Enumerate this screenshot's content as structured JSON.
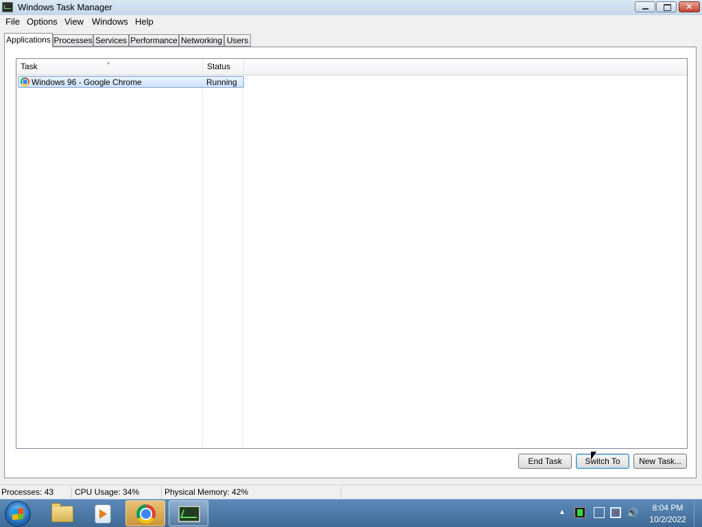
{
  "window": {
    "title": "Windows Task Manager"
  },
  "menu": [
    "File",
    "Options",
    "View",
    "Windows",
    "Help"
  ],
  "tabs": [
    "Applications",
    "Processes",
    "Services",
    "Performance",
    "Networking",
    "Users"
  ],
  "active_tab": "Applications",
  "list": {
    "columns": [
      "Task",
      "Status"
    ],
    "rows": [
      {
        "task": "Windows 96 - Google Chrome",
        "status": "Running",
        "icon": "chrome-icon"
      }
    ]
  },
  "buttons": {
    "end_task": "End Task",
    "switch_to": "Switch To",
    "new_task": "New Task..."
  },
  "status": {
    "processes": "Processes: 43",
    "cpu": "CPU Usage: 34%",
    "memory": "Physical Memory: 42%"
  },
  "taskbar": {
    "items": [
      "start-orb",
      "windows-explorer-icon",
      "media-player-icon",
      "google-chrome-icon",
      "task-manager-icon"
    ],
    "clock_time": "8:04 PM",
    "clock_date": "10/2/2022"
  }
}
